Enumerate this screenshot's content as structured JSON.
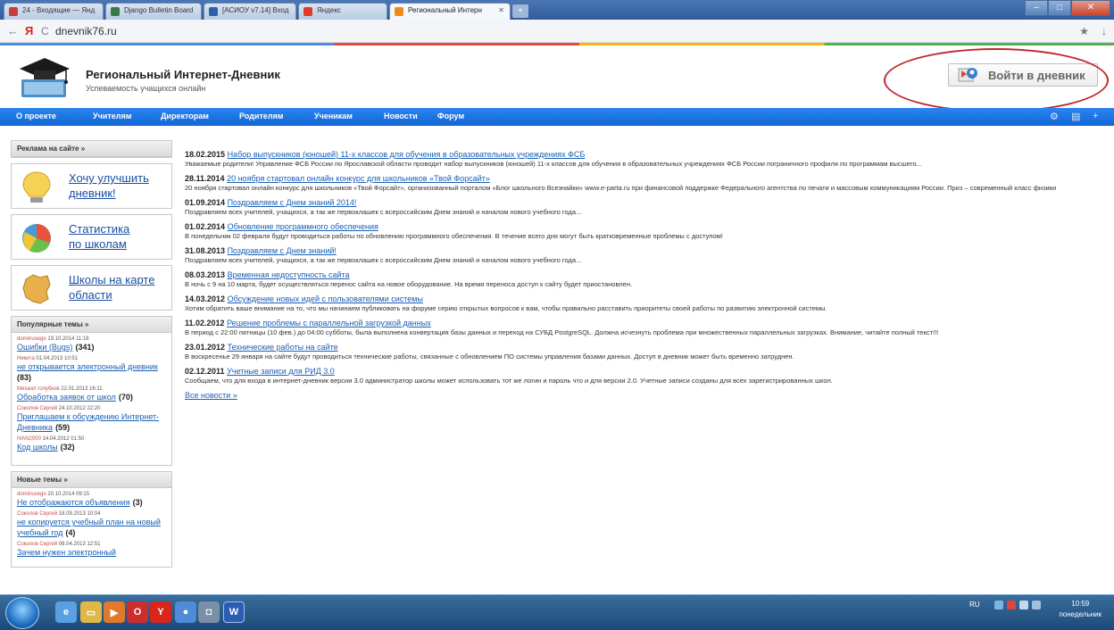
{
  "browser": {
    "tabs": [
      {
        "label": "24 - Входящие — Янд"
      },
      {
        "label": "Django Bulletin Board"
      },
      {
        "label": "[АСИОУ v7.14] Вход"
      },
      {
        "label": "Яндекс"
      },
      {
        "label": "Региональный Интерн"
      }
    ],
    "url": "dnevnik76.ru",
    "back_glyph": "←",
    "yandex_glyph": "Я",
    "reload_glyph": "C",
    "star_glyph": "★",
    "download_glyph": "↓"
  },
  "site": {
    "title": "Региональный Интернет-Дневник",
    "subtitle": "Успеваемость учащихся онлайн",
    "login_button": "Войти в дневник"
  },
  "nav": {
    "items": [
      {
        "label": "О проекте"
      },
      {
        "label": "Учителям"
      },
      {
        "label": "Директорам"
      },
      {
        "label": "Родителям"
      },
      {
        "label": "Ученикам"
      },
      {
        "label": "Новости"
      },
      {
        "label": "Форум"
      }
    ]
  },
  "sidebar": {
    "ads_header": "Реклама на сайте »",
    "promos": [
      {
        "line1": "Хочу улучшить",
        "line2": "дневник!"
      },
      {
        "line1": "Статистика",
        "line2": "по школам"
      },
      {
        "line1": "Школы на карте",
        "line2": "области"
      }
    ],
    "popular_header": "Популярные темы »",
    "popular": [
      {
        "author": "dominusego",
        "date": "19.10.2014 11:18",
        "title": "Ошибки (Bugs)",
        "count": "(341)"
      },
      {
        "author": "Никита",
        "date": "01.04.2013 10:51",
        "title": "не открывается электронный дневник",
        "count": "(83)"
      },
      {
        "author": "Михаил голубков",
        "date": "22.01.2013 16:11",
        "title": "Обработка заявок от школ",
        "count": "(70)"
      },
      {
        "author": "Соколов Сергей",
        "date": "24.10.2012 22:20",
        "title": "Приглашаем к обсуждению Интернет-Дневника",
        "count": "(59)"
      },
      {
        "author": "IVAN2000",
        "date": "14.04.2012 01:50",
        "title": "Код школы",
        "count": "(32)"
      }
    ],
    "new_header": "Новые темы »",
    "new_topics": [
      {
        "author": "dominusego",
        "date": "20.10.2014 09:15",
        "title": "Не отображаются объявления",
        "count": "(3)"
      },
      {
        "author": "Соколов Сергей",
        "date": "18.09.2013 10:04",
        "title": "не копируется учебный план на новый учебный год",
        "count": "(4)"
      },
      {
        "author": "Соколов Сергей",
        "date": "08.04.2013 12:51",
        "title": "Зачем нужен электронный",
        "count": ""
      }
    ]
  },
  "news": {
    "items": [
      {
        "date": "18.02.2015",
        "title": "Набор выпускников (юношей) 11-х классов для обучения в образовательных учреждениях ФСБ",
        "body": "Уважаемые родители! Управление ФСБ России по Ярославской области проводит набор выпускников (юношей) 11-х классов для обучения в образовательных учреждениях ФСБ России пограничного профиля по программам высшего..."
      },
      {
        "date": "28.11.2014",
        "title": "20 ноября стартовал онлайн конкурс для школьников «Твой Форсайт»",
        "body": "20 ноября стартовал онлайн конкурс для школьников «Твой Форсайт», организованный порталом «Блог школьного Всезнайки» www.e-parta.ru при финансовой поддержке Федерального агентства по печати и массовым коммуникациям России. Приз – современный класс физики"
      },
      {
        "date": "01.09.2014",
        "title": "Поздравляем с Днем знаний 2014!",
        "body": "Поздравляем всех учителей, учащихся, а так же первоклашек с всероссийским Днем знаний и началом нового учебного года..."
      },
      {
        "date": "01.02.2014",
        "title": "Обновление программного обеспечения",
        "body": "В понедельник 02 февраля будут проводиться работы по обновлению программного обеспечения. В течение всего дня могут быть кратковременные проблемы с доступом!"
      },
      {
        "date": "31.08.2013",
        "title": "Поздравляем с Днем знаний!",
        "body": "Поздравляем всех учителей, учащихся, а так же первоклашек с всероссийским Днем знаний и началом нового учебного года..."
      },
      {
        "date": "08.03.2013",
        "title": "Временная недоступность сайта",
        "body": "В ночь с 9 на 10 марта, будет осуществляться перенос сайта на новое оборудование. На время переноса доступ к сайту будет приостановлен."
      },
      {
        "date": "14.03.2012",
        "title": "Обсуждение новых идей с пользователями системы",
        "body": "Хотим обратить ваше внимание на то, что мы начинаем публиковать на форуме серию открытых вопросов к вам, чтобы правильно расставить приоритеты своей работы по развитию электронной системы."
      },
      {
        "date": "11.02.2012",
        "title": "Решение проблемы с параллельной загрузкой данных",
        "body": "В период с 22:00 пятницы (10 фев.) до 04:00 субботы, была выполнена конвертация базы данных и переход на СУБД PostgreSQL. Должна исчезнуть проблема при множественных параллельных загрузках. Внимание, читайте полный текст!!!"
      },
      {
        "date": "23.01.2012",
        "title": "Технические работы на сайте",
        "body": "В воскресенье 29 января на сайте будут проводиться технические работы, связанные с обновлением ПО системы управления базами данных. Доступ в дневник может быть временно затруднен."
      },
      {
        "date": "02.12.2011",
        "title": "Учетные записи для РИД 3.0",
        "body": "Сообщаем, что для входа в интернет-дневник версии 3.0 администратор школы может использовать тот же логин и пароль что и для версии 2.0. Учетные записи созданы для всех зарегистрированных школ."
      }
    ],
    "all_news": "Все новости »"
  },
  "taskbar": {
    "lang": "RU",
    "time": "10:59",
    "day": "понедельник"
  },
  "colors": {
    "nav_blue": "#1a73e0",
    "link": "#1a5fb4",
    "highlight": "#c0272d"
  }
}
